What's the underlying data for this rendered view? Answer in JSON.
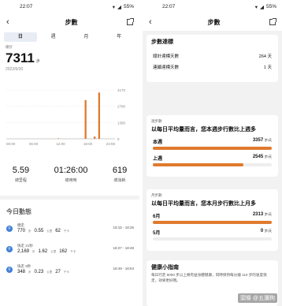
{
  "status": {
    "time": "22:07",
    "battery": "55%"
  },
  "left": {
    "title": "步數",
    "tabs": [
      "日",
      "週",
      "月",
      "年"
    ],
    "total_label": "總計",
    "steps": "7311",
    "steps_unit": "步",
    "date": "2022/6/30",
    "chart_data": {
      "type": "bar",
      "x_ticks": [
        "00:00",
        "06:00",
        "12:00",
        "18:00",
        "23:59"
      ],
      "y_ticks": [
        "4170",
        "2780",
        "1390",
        "0"
      ],
      "ylim": [
        0,
        4170
      ],
      "hours": [
        0,
        1,
        2,
        3,
        4,
        5,
        6,
        7,
        8,
        9,
        10,
        11,
        12,
        13,
        14,
        15,
        16,
        17,
        18,
        19,
        20,
        21,
        22,
        23
      ],
      "values": [
        0,
        0,
        0,
        0,
        0,
        0,
        0,
        0,
        0,
        0,
        0,
        40,
        0,
        0,
        0,
        0,
        0,
        3300,
        0,
        190,
        3950,
        0,
        0,
        0
      ],
      "bar_color": "#e07a2e"
    },
    "stats": [
      {
        "value": "5.59",
        "label": "總里程"
      },
      {
        "value": "01:26:00",
        "label": "總用時"
      },
      {
        "value": "619",
        "label": "總消耗"
      }
    ],
    "activities_title": "今日動態",
    "activities": [
      {
        "name": "健走",
        "steps": "770",
        "steps_u": "步",
        "dist": "0.55",
        "dist_u": "公里",
        "cal": "62",
        "cal_u": "千卡",
        "time": "18:15 - 18:26"
      },
      {
        "name": "快走 21秒",
        "steps": "2,169",
        "steps_u": "步",
        "dist": "1.62",
        "dist_u": "公里",
        "cal": "162",
        "cal_u": "千卡",
        "time": "18:27 - 18:48"
      },
      {
        "name": "快走 5秒",
        "steps": "348",
        "steps_u": "步",
        "dist": "0.23",
        "dist_u": "公里",
        "cal": "27",
        "cal_u": "千卡",
        "time": "18:49 - 18:54"
      }
    ]
  },
  "right": {
    "title": "步數",
    "goal_card": {
      "title": "步數達標",
      "rows": [
        {
          "label": "總計達標天數",
          "value": "264 天"
        },
        {
          "label": "連續達標天數",
          "value": "1 天"
        }
      ]
    },
    "week_card": {
      "sub": "週步數",
      "question": "以每日平均量而言，您本週步行數比上週多",
      "items": [
        {
          "label": "本週",
          "value": "3357",
          "unit": "步/天",
          "fraction": 1.0,
          "color": "#e07a2e"
        },
        {
          "label": "上週",
          "value": "2545",
          "unit": "步/天",
          "fraction": 0.76,
          "color": "#e07a2e"
        }
      ]
    },
    "month_card": {
      "sub": "月步數",
      "question": "以每日平均量而言，您本月步行數比上月多",
      "items": [
        {
          "label": "6月",
          "value": "2313",
          "unit": "步/天",
          "fraction": 1.0,
          "color": "#e07a2e"
        },
        {
          "label": "5月",
          "value": "0",
          "unit": "步/天",
          "fraction": 0.0,
          "color": "#e07a2e"
        }
      ]
    },
    "guide_card": {
      "title": "健康小指南",
      "text": "每日行走 8000 步以上將有益身體健康，同時保持每分鐘 110 步的速度快走，效果更好哦。"
    },
    "watermark": "頭條 @五瀰狗"
  }
}
